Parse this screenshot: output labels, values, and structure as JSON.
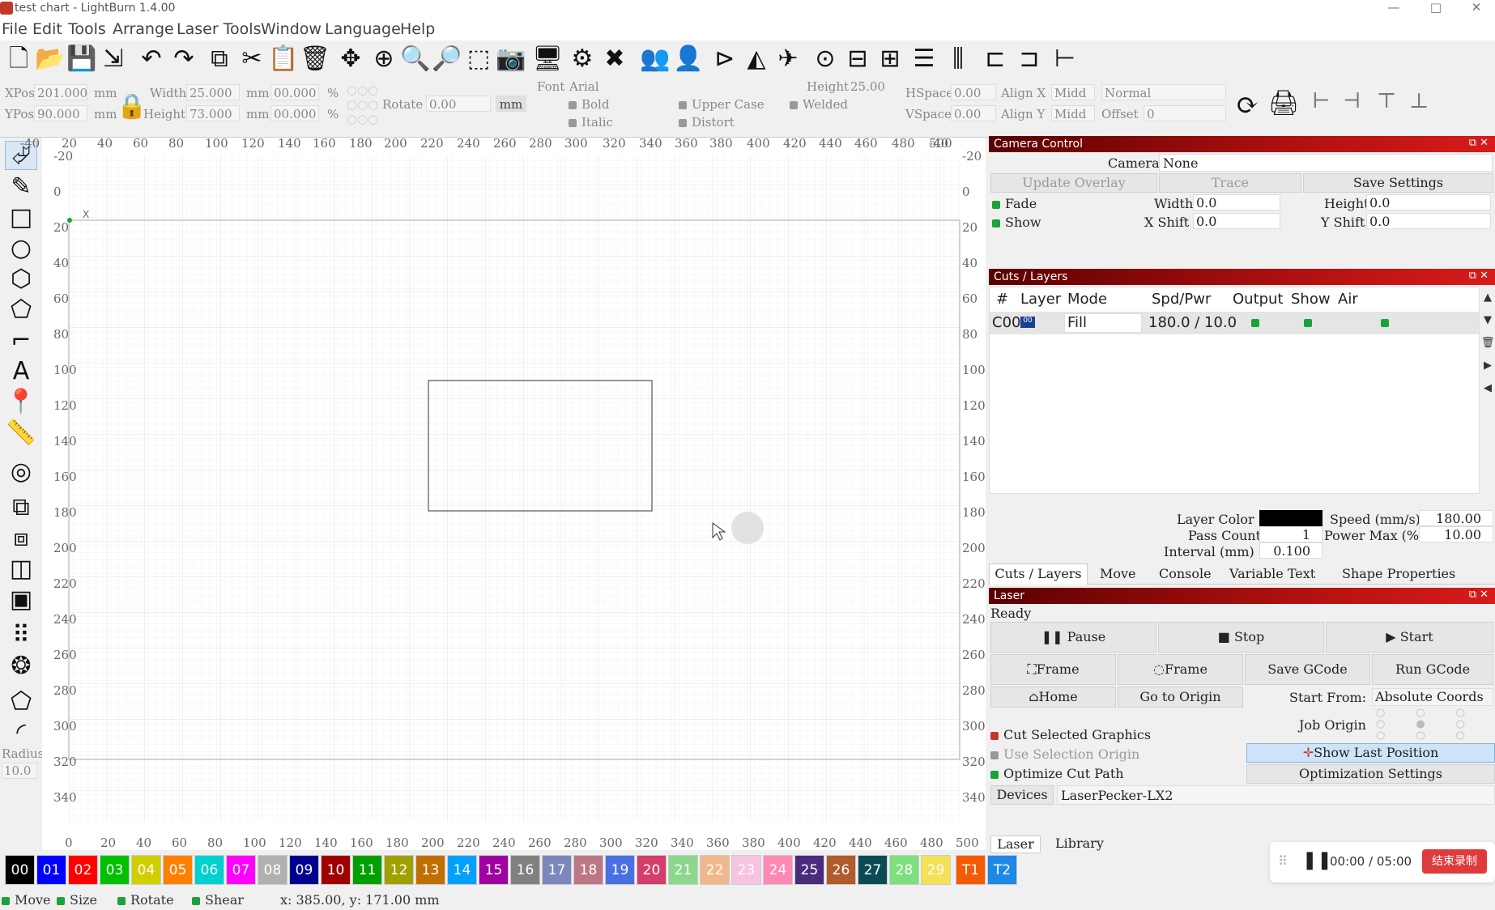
{
  "window": {
    "title": "test chart - LightBurn 1.4.00",
    "min": "—",
    "max": "□",
    "close": "✕"
  },
  "menu": [
    "File",
    "Edit",
    "Tools",
    "Arrange",
    "Laser Tools",
    "Window",
    "Language",
    "Help"
  ],
  "toolbar_icons": [
    "new-file-icon",
    "open-folder-icon",
    "save-icon",
    "export-icon",
    "undo-icon",
    "redo-icon",
    "copy-icon",
    "cut-icon",
    "paste-icon",
    "delete-icon",
    "move-icon",
    "zoom-page-icon",
    "zoom-in-icon",
    "zoom-out-icon",
    "zoom-selection-icon",
    "camera-icon",
    "monitor-icon",
    "settings-icon",
    "tools-icon",
    "group-icon",
    "ungroup-icon",
    "align-icon",
    "mirror-icon",
    "send-icon",
    "target-icon",
    "align-center-icon",
    "distribute-icon",
    "distribute-h-icon",
    "distribute-v-icon",
    "space-h-icon",
    "space-v-icon",
    "dock-icon"
  ],
  "props": {
    "xpos_label": "XPos",
    "xpos": "201.000",
    "ypos_label": "YPos",
    "ypos": "90.000",
    "unit": "mm",
    "width_label": "Width",
    "width": "25.000",
    "height_label": "Height",
    "height": "73.000",
    "pct1": "00.000",
    "pct2": "00.000",
    "pct": "%",
    "rotate_label": "Rotate",
    "rotate": "0.00",
    "mm_btn": "mm",
    "font_label": "Font",
    "font_value": "Arial",
    "text_height_label": "Height",
    "text_height": "25.00",
    "bold": "Bold",
    "italic": "Italic",
    "upper": "Upper Case",
    "distort": "Distort",
    "welded": "Welded",
    "hspace_label": "HSpace",
    "hspace": "0.00",
    "vspace_label": "VSpace",
    "vspace": "0.00",
    "alignx_label": "Align X",
    "alignx": "Midd",
    "aligny_label": "Align Y",
    "aligny": "Midd",
    "normal": "Normal",
    "offset_label": "Offset",
    "offset": "0"
  },
  "ruler": {
    "top": [
      "-40",
      "20",
      "40",
      "60",
      "80",
      "100",
      "120",
      "140",
      "160",
      "180",
      "200",
      "220",
      "240",
      "260",
      "280",
      "300",
      "320",
      "340",
      "360",
      "380",
      "400",
      "420",
      "440",
      "460",
      "480",
      "500",
      "-40"
    ],
    "left": [
      "-20",
      "0",
      "20",
      "40",
      "60",
      "80",
      "100",
      "120",
      "140",
      "160",
      "180",
      "200",
      "220",
      "240",
      "260",
      "280",
      "300",
      "320",
      "340"
    ],
    "bottom": [
      "0",
      "20",
      "40",
      "60",
      "80",
      "100",
      "120",
      "140",
      "160",
      "180",
      "200",
      "220",
      "240",
      "260",
      "280",
      "300",
      "320",
      "340",
      "360",
      "380",
      "400",
      "420",
      "440",
      "460",
      "480",
      "500"
    ],
    "right": [
      "-20",
      "0",
      "20",
      "40",
      "60",
      "80",
      "100",
      "120",
      "140",
      "160",
      "180",
      "200",
      "220",
      "240",
      "260",
      "280",
      "300",
      "320",
      "340"
    ]
  },
  "camera": {
    "title": "Camera Control",
    "camera_label": "Camera:",
    "camera_value": "None",
    "update": "Update Overlay",
    "trace": "Trace",
    "save": "Save Settings",
    "fade": "Fade",
    "show": "Show",
    "width_label": "Width",
    "width": "0.0",
    "height_label": "Height",
    "height": "0.0",
    "xshift_label": "X Shift",
    "xshift": "0.0",
    "yshift_label": "Y Shift",
    "yshift": "0.0"
  },
  "cuts": {
    "title": "Cuts / Layers",
    "headers": [
      "#",
      "Layer",
      "Mode",
      "Spd/Pwr",
      "Output",
      "Show",
      "Air"
    ],
    "row": {
      "id": "C00",
      "layer": "00",
      "mode": "Fill",
      "spdpwr": "180.0 / 10.0"
    },
    "layer_color_label": "Layer Color",
    "speed_label": "Speed (mm/s)",
    "speed": "180.00",
    "pass_label": "Pass Count",
    "pass": "1",
    "power_label": "Power Max (%)",
    "power": "10.00",
    "interval_label": "Interval (mm)",
    "interval": "0.100",
    "layer_color": "#000000"
  },
  "tabs": [
    "Cuts / Layers",
    "Move",
    "Console",
    "Variable Text",
    "Shape Properties"
  ],
  "laser": {
    "title": "Laser",
    "status": "Ready",
    "pause": "Pause",
    "stop": "Stop",
    "start": "Start",
    "frame1": "Frame",
    "frame2": "Frame",
    "save_gcode": "Save GCode",
    "run_gcode": "Run GCode",
    "home": "Home",
    "go_origin": "Go to Origin",
    "start_from_label": "Start From:",
    "start_from": "Absolute Coords",
    "job_origin": "Job Origin",
    "cut_selected": "Cut Selected Graphics",
    "use_sel_origin": "Use Selection Origin",
    "optimize": "Optimize Cut Path",
    "show_last": "Show Last Position",
    "opt_settings": "Optimization Settings",
    "devices": "Devices",
    "device": "LaserPecker-LX2"
  },
  "bottom_tabs": [
    "Laser",
    "Library"
  ],
  "palette": [
    {
      "label": "00",
      "color": "#000000"
    },
    {
      "label": "01",
      "color": "#0000ff"
    },
    {
      "label": "02",
      "color": "#ff0000"
    },
    {
      "label": "03",
      "color": "#00c000"
    },
    {
      "label": "04",
      "color": "#d0d000"
    },
    {
      "label": "05",
      "color": "#ff8000"
    },
    {
      "label": "06",
      "color": "#00d0d0"
    },
    {
      "label": "07",
      "color": "#ff00ff"
    },
    {
      "label": "08",
      "color": "#b0b0b0"
    },
    {
      "label": "09",
      "color": "#000090"
    },
    {
      "label": "10",
      "color": "#a00000"
    },
    {
      "label": "11",
      "color": "#00a000"
    },
    {
      "label": "12",
      "color": "#a0a000"
    },
    {
      "label": "13",
      "color": "#c07000"
    },
    {
      "label": "14",
      "color": "#00a0ff"
    },
    {
      "label": "15",
      "color": "#a000a0"
    },
    {
      "label": "16",
      "color": "#808080"
    },
    {
      "label": "17",
      "color": "#7d87b9"
    },
    {
      "label": "18",
      "color": "#bb7784"
    },
    {
      "label": "19",
      "color": "#4a6fe3"
    },
    {
      "label": "20",
      "color": "#d33f6a"
    },
    {
      "label": "21",
      "color": "#8cd78c"
    },
    {
      "label": "22",
      "color": "#f0b98d"
    },
    {
      "label": "23",
      "color": "#f6c4e1"
    },
    {
      "label": "24",
      "color": "#fe89b3"
    },
    {
      "label": "25",
      "color": "#4a2c7c"
    },
    {
      "label": "26",
      "color": "#b05b2b"
    },
    {
      "label": "27",
      "color": "#0b4b56"
    },
    {
      "label": "28",
      "color": "#7ddf7d"
    },
    {
      "label": "29",
      "color": "#f3e157"
    },
    {
      "label": "T1",
      "color": "#f35b04"
    },
    {
      "label": "T2",
      "color": "#1e88e5"
    }
  ],
  "status": {
    "move": "Move",
    "size": "Size",
    "rotate": "Rotate",
    "shear": "Shear",
    "coords": "x: 385.00, y: 171.00 mm",
    "radius_label": "Radius:",
    "radius": "10.0"
  },
  "recorder": {
    "time": "00:00 / 05:00",
    "end": "结束录制"
  }
}
